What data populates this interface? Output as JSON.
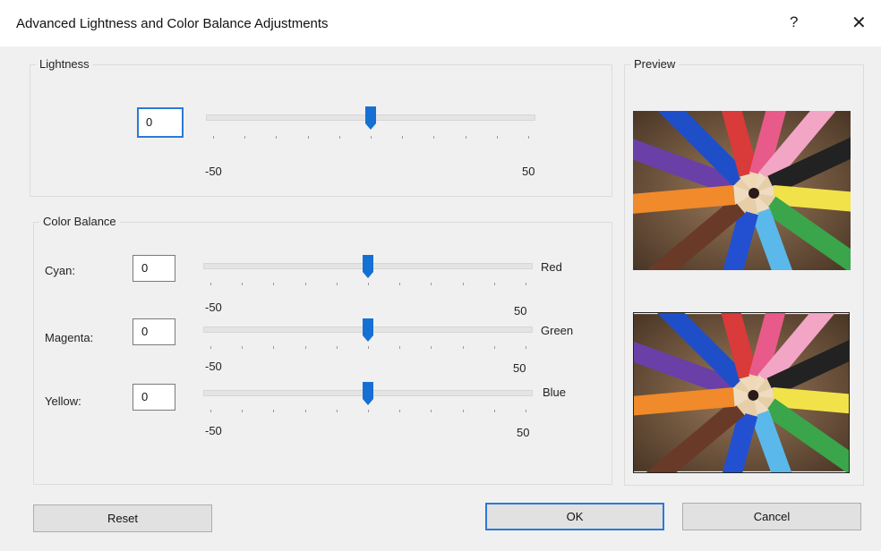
{
  "window": {
    "title": "Advanced Lightness and Color Balance Adjustments",
    "help_glyph": "?",
    "close_glyph": "✕"
  },
  "lightness": {
    "group_label": "Lightness",
    "value": "0",
    "min_label": "-50",
    "max_label": "50",
    "slider_value": 0
  },
  "color_balance": {
    "group_label": "Color Balance",
    "rows": [
      {
        "left_label": "Cyan:",
        "value": "0",
        "right_label": "Red",
        "min_label": "-50",
        "max_label": "50",
        "slider_value": 0
      },
      {
        "left_label": "Magenta:",
        "value": "0",
        "right_label": "Green",
        "min_label": "-50",
        "max_label": "50",
        "slider_value": 0
      },
      {
        "left_label": "Yellow:",
        "value": "0",
        "right_label": "Blue",
        "min_label": "-50",
        "max_label": "50",
        "slider_value": 0
      }
    ]
  },
  "preview": {
    "group_label": "Preview"
  },
  "buttons": {
    "reset": "Reset",
    "ok": "OK",
    "cancel": "Cancel"
  },
  "colors": {
    "accent": "#2b79d8",
    "thumb": "#1670d4"
  }
}
